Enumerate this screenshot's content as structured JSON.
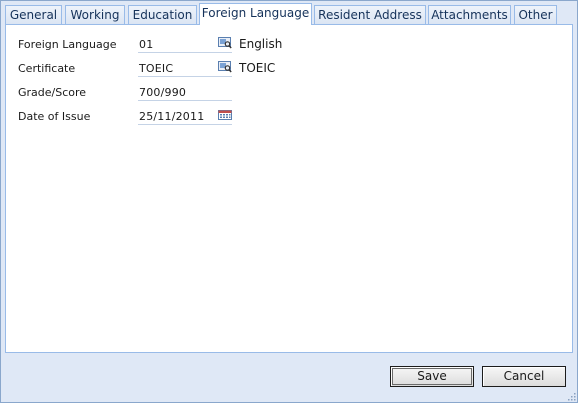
{
  "tabs": [
    {
      "label": "General"
    },
    {
      "label": "Working"
    },
    {
      "label": "Education"
    },
    {
      "label": "Foreign Language"
    },
    {
      "label": "Resident Address"
    },
    {
      "label": "Attachments"
    },
    {
      "label": "Other"
    }
  ],
  "active_tab": "Foreign Language",
  "form": {
    "foreign_language": {
      "label": "Foreign Language",
      "value": "01",
      "description": "English"
    },
    "certificate": {
      "label": "Certificate",
      "value": "TOEIC",
      "description": "TOEIC"
    },
    "grade_score": {
      "label": "Grade/Score",
      "value": "700/990"
    },
    "date_of_issue": {
      "label": "Date of Issue",
      "value": "25/11/2011"
    }
  },
  "buttons": {
    "save": "Save",
    "cancel": "Cancel"
  },
  "colors": {
    "frame_background": "#dfe8f6",
    "tab_border": "#99bbe8",
    "field_underline": "#c5d3e6"
  },
  "icons": {
    "lookup": "lookup-icon",
    "calendar": "calendar-icon"
  }
}
